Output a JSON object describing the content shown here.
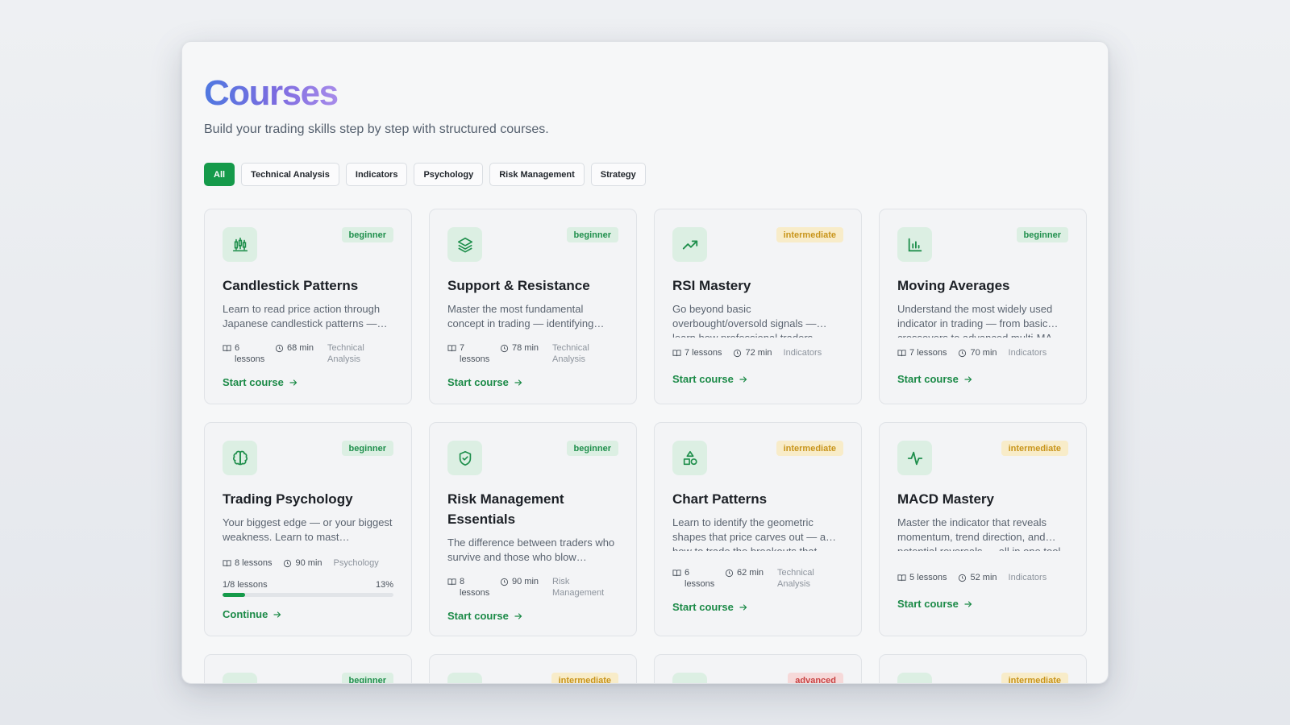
{
  "header": {
    "title": "Courses",
    "subtitle": "Build your trading skills step by step with structured courses."
  },
  "filters": [
    "All",
    "Technical Analysis",
    "Indicators",
    "Psychology",
    "Risk Management",
    "Strategy"
  ],
  "colors": {
    "accent": "#159a4a",
    "beginner": "#1f8f4c",
    "intermediate": "#c8941a",
    "advanced": "#c94444"
  },
  "courses": [
    {
      "icon": "candlestick-icon",
      "level": "beginner",
      "title": "Candlestick Patterns",
      "desc": "Learn to read price action through Japanese candlestick patterns —…",
      "lessons": "6 lessons",
      "minutes": "68 min",
      "category": "Technical Analysis",
      "cta": "Start course"
    },
    {
      "icon": "layers-icon",
      "level": "beginner",
      "title": "Support & Resistance",
      "desc": "Master the most fundamental concept in trading — identifying…",
      "lessons": "7 lessons",
      "minutes": "78 min",
      "category": "Technical Analysis",
      "cta": "Start course"
    },
    {
      "icon": "trending-up-icon",
      "level": "intermediate",
      "title": "RSI Mastery",
      "desc": "Go beyond basic overbought/oversold signals —… learn how professional traders",
      "lessons": "7 lessons",
      "minutes": "72 min",
      "category": "Indicators",
      "cta": "Start course"
    },
    {
      "icon": "bar-chart-icon",
      "level": "beginner",
      "title": "Moving Averages",
      "desc": "Understand the most widely used indicator in trading — from basic… crossovers to advanced multi-MA",
      "lessons": "7 lessons",
      "minutes": "70 min",
      "category": "Indicators",
      "cta": "Start course"
    },
    {
      "icon": "brain-icon",
      "level": "beginner",
      "title": "Trading Psychology",
      "desc": "Your biggest edge — or your biggest weakness. Learn to mast…",
      "lessons": "8 lessons",
      "minutes": "90 min",
      "category": "Psychology",
      "progress_label": "1/8 lessons",
      "progress_pct": "13%",
      "progress": 0.13,
      "cta": "Continue"
    },
    {
      "icon": "shield-check-icon",
      "level": "beginner",
      "title": "Risk Management Essentials",
      "desc": "The difference between traders who survive and those who blow…",
      "lessons": "8 lessons",
      "minutes": "90 min",
      "category": "Risk Management",
      "cta": "Start course"
    },
    {
      "icon": "shapes-icon",
      "level": "intermediate",
      "title": "Chart Patterns",
      "desc": "Learn to identify the geometric shapes that price carves out — a… how to trade the breakouts that",
      "lessons": "6 lessons",
      "minutes": "62 min",
      "category": "Technical Analysis",
      "cta": "Start course"
    },
    {
      "icon": "activity-icon",
      "level": "intermediate",
      "title": "MACD Mastery",
      "desc": "Master the indicator that reveals momentum, trend direction, and… potential reversals — all in one tool.",
      "lessons": "5 lessons",
      "minutes": "52 min",
      "category": "Indicators",
      "cta": "Start course"
    }
  ],
  "next_row_levels": [
    "beginner",
    "intermediate",
    "advanced",
    "intermediate"
  ]
}
